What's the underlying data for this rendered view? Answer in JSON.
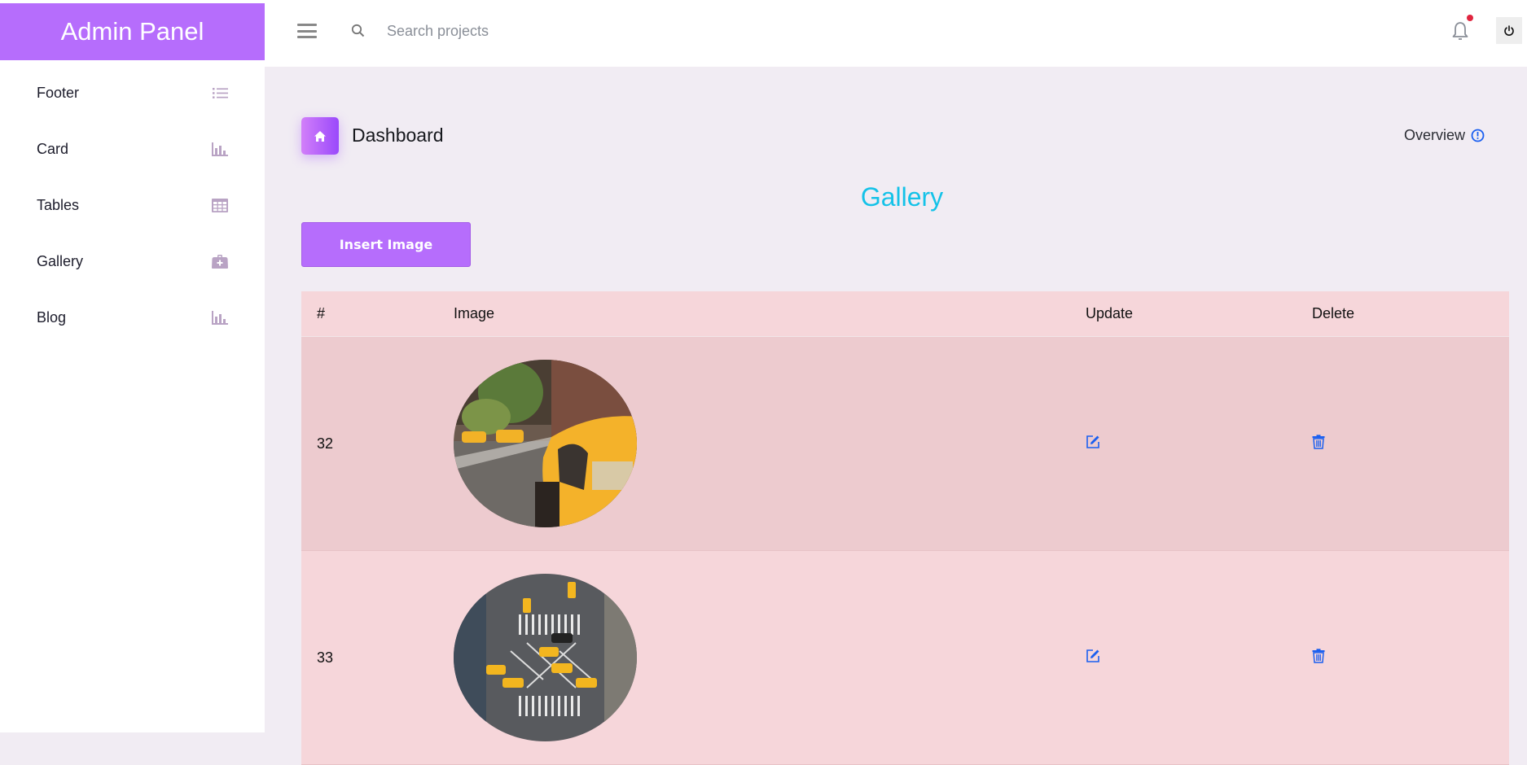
{
  "sidebar": {
    "brand": "Admin Panel",
    "items": [
      {
        "label": "Footer",
        "icon": "list-icon"
      },
      {
        "label": "Card",
        "icon": "bar-chart-icon"
      },
      {
        "label": "Tables",
        "icon": "table-icon"
      },
      {
        "label": "Gallery",
        "icon": "medical-bag-icon"
      },
      {
        "label": "Blog",
        "icon": "bar-chart-icon"
      }
    ]
  },
  "topbar": {
    "search_placeholder": "Search projects",
    "notification_badge": true
  },
  "page": {
    "title": "Dashboard",
    "overview_label": "Overview",
    "section_title": "Gallery",
    "insert_button": "Insert Image"
  },
  "table": {
    "headers": [
      "#",
      "Image",
      "Update",
      "Delete"
    ],
    "rows": [
      {
        "id": "32",
        "image": "yellow taxi on city street"
      },
      {
        "id": "33",
        "image": "aerial view of crosswalk intersection with taxis"
      }
    ]
  },
  "colors": {
    "brand": "#b66dfc",
    "gallery_title": "#14c2e8",
    "action_icon": "#1a5ff0",
    "sidebar_icon": "#b9a3c4"
  }
}
